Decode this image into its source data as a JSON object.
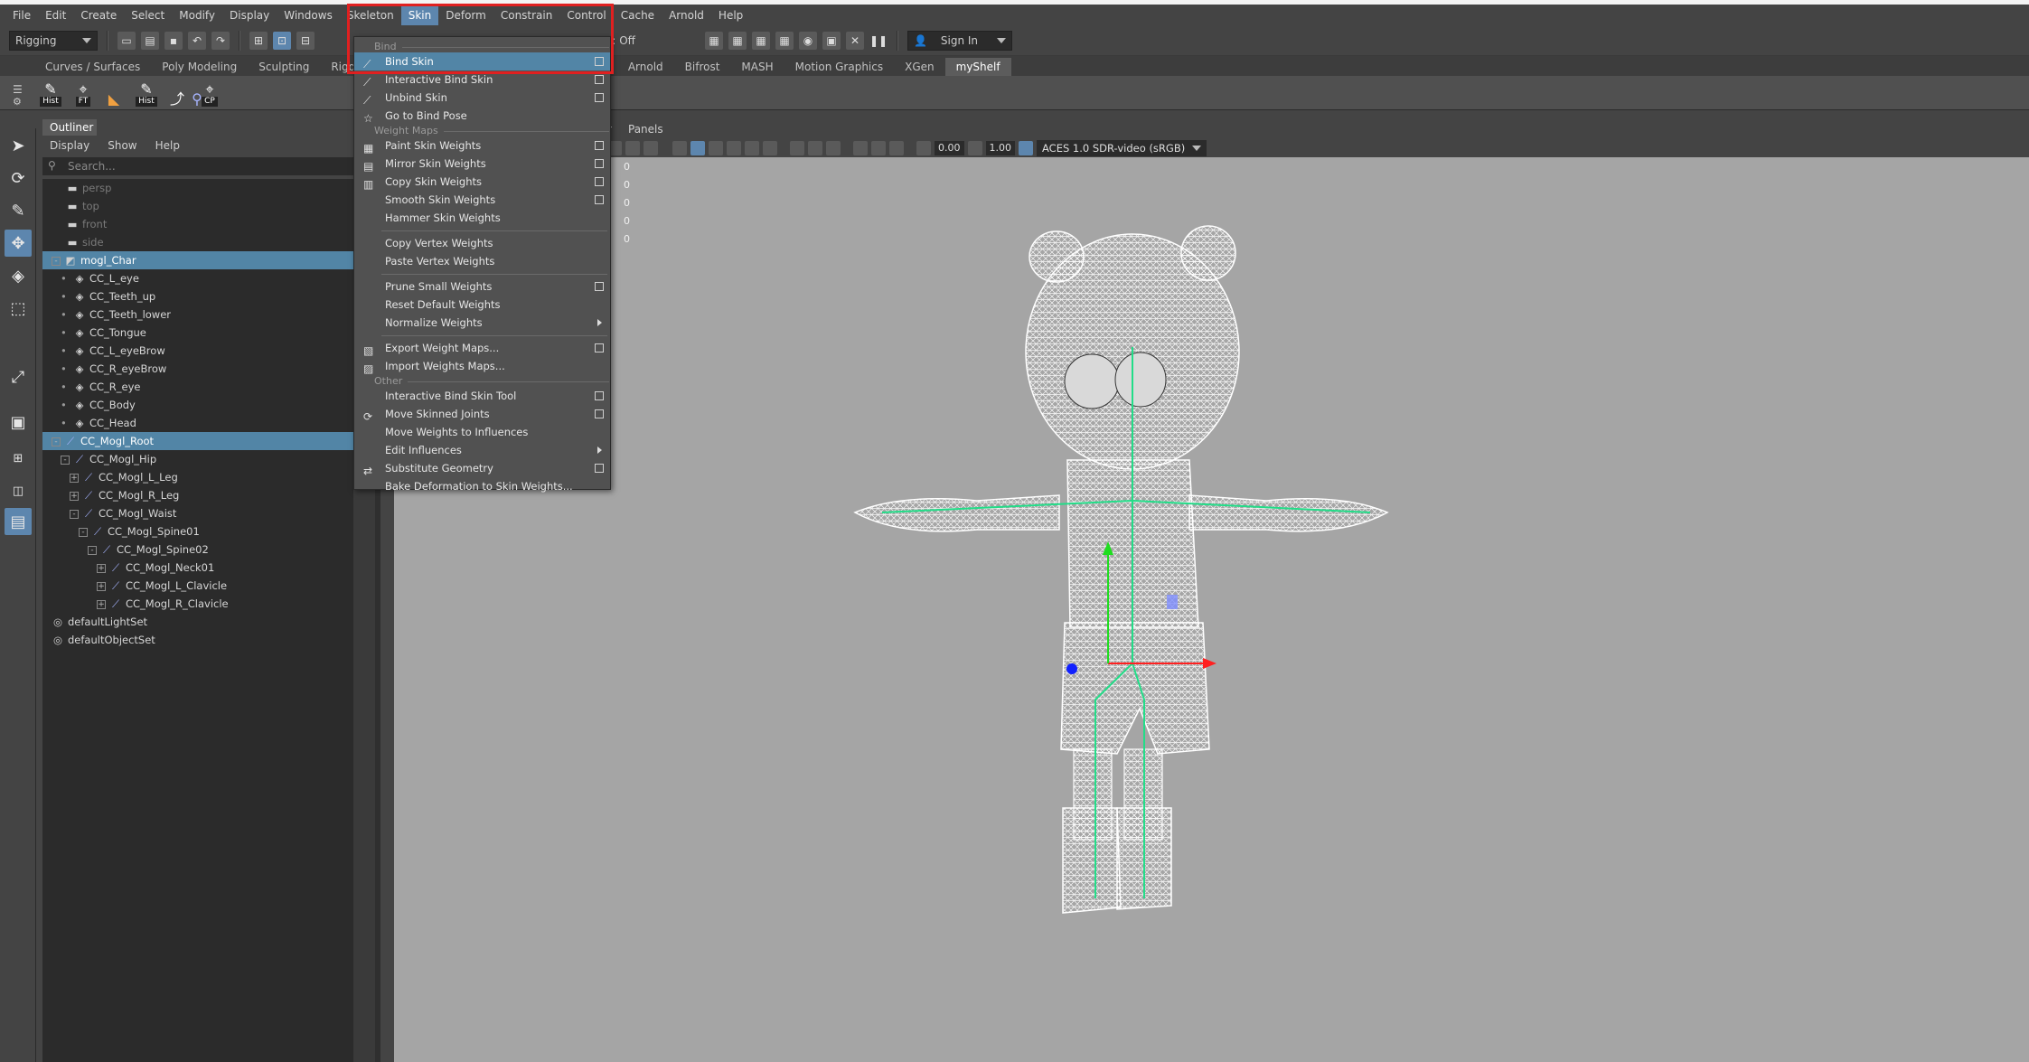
{
  "menubar": {
    "items": [
      "File",
      "Edit",
      "Create",
      "Select",
      "Modify",
      "Display",
      "Windows",
      "Skeleton",
      "Skin",
      "Deform",
      "Constrain",
      "Control",
      "Cache",
      "Arnold",
      "Help"
    ],
    "active": "Skin"
  },
  "statusline": {
    "mode": "Rigging",
    "symmetry": "Symmetry: Off",
    "sign_in": "Sign In"
  },
  "shelf": {
    "tabs": [
      "Curves / Surfaces",
      "Poly Modeling",
      "Sculpting",
      "Rigging",
      "",
      "stom",
      "Arnold",
      "Bifrost",
      "MASH",
      "Motion Graphics",
      "XGen",
      "myShelf"
    ],
    "selected": "myShelf",
    "buttons": [
      "Hist",
      "FT",
      "",
      "Hist",
      "",
      "",
      "CP"
    ]
  },
  "outliner": {
    "tab": "Outliner",
    "menu": [
      "Display",
      "Show",
      "Help"
    ],
    "search_placeholder": "Search...",
    "rows": [
      {
        "label": "persp",
        "icon": "camera-icon",
        "indent": 0,
        "dim": true
      },
      {
        "label": "top",
        "icon": "camera-icon",
        "indent": 0,
        "dim": true
      },
      {
        "label": "front",
        "icon": "camera-icon",
        "indent": 0,
        "dim": true
      },
      {
        "label": "side",
        "icon": "camera-icon",
        "indent": 0,
        "dim": true
      },
      {
        "label": "mogl_Char",
        "icon": "mesh-group-icon",
        "indent": 0,
        "selected": true,
        "expander": "-"
      },
      {
        "label": "CC_L_eye",
        "icon": "transform-icon",
        "indent": 1
      },
      {
        "label": "CC_Teeth_up",
        "icon": "transform-icon",
        "indent": 1
      },
      {
        "label": "CC_Teeth_lower",
        "icon": "transform-icon",
        "indent": 1
      },
      {
        "label": "CC_Tongue",
        "icon": "transform-icon",
        "indent": 1
      },
      {
        "label": "CC_L_eyeBrow",
        "icon": "transform-icon",
        "indent": 1
      },
      {
        "label": "CC_R_eyeBrow",
        "icon": "transform-icon",
        "indent": 1
      },
      {
        "label": "CC_R_eye",
        "icon": "transform-icon",
        "indent": 1
      },
      {
        "label": "CC_Body",
        "icon": "transform-icon",
        "indent": 1
      },
      {
        "label": "CC_Head",
        "icon": "transform-icon",
        "indent": 1
      },
      {
        "label": "CC_Mogl_Root",
        "icon": "joint-icon",
        "indent": 0,
        "selected": true,
        "expander": "-"
      },
      {
        "label": "CC_Mogl_Hip",
        "icon": "joint-icon",
        "indent": 1,
        "expander": "-"
      },
      {
        "label": "CC_Mogl_L_Leg",
        "icon": "joint-icon",
        "indent": 2,
        "expander": "+"
      },
      {
        "label": "CC_Mogl_R_Leg",
        "icon": "joint-icon",
        "indent": 2,
        "expander": "+"
      },
      {
        "label": "CC_Mogl_Waist",
        "icon": "joint-icon",
        "indent": 2,
        "expander": "-"
      },
      {
        "label": "CC_Mogl_Spine01",
        "icon": "joint-icon",
        "indent": 3,
        "expander": "-"
      },
      {
        "label": "CC_Mogl_Spine02",
        "icon": "joint-icon",
        "indent": 4,
        "expander": "-"
      },
      {
        "label": "CC_Mogl_Neck01",
        "icon": "joint-icon",
        "indent": 5,
        "expander": "+"
      },
      {
        "label": "CC_Mogl_L_Clavicle",
        "icon": "joint-icon",
        "indent": 5,
        "expander": "+"
      },
      {
        "label": "CC_Mogl_R_Clavicle",
        "icon": "joint-icon",
        "indent": 5,
        "expander": "+"
      },
      {
        "label": "defaultLightSet",
        "icon": "set-icon",
        "indent": 0
      },
      {
        "label": "defaultObjectSet",
        "icon": "set-icon",
        "indent": 0
      }
    ]
  },
  "viewport": {
    "menu": [
      "rer",
      "Panels"
    ],
    "value1": "0.00",
    "value2": "1.00",
    "colorspace": "ACES 1.0 SDR-video (sRGB)",
    "hud": [
      "0",
      "0",
      "0",
      "0",
      "0"
    ]
  },
  "skin_menu": {
    "items": [
      {
        "type": "header",
        "label": "Bind"
      },
      {
        "type": "item",
        "label": "Bind Skin",
        "option": true,
        "highlighted": true,
        "icon": "bind-skin-icon"
      },
      {
        "type": "item",
        "label": "Interactive Bind Skin",
        "option": true,
        "icon": "interactive-bind-icon"
      },
      {
        "type": "item",
        "label": "Unbind Skin",
        "option": true,
        "icon": "unbind-icon"
      },
      {
        "type": "item",
        "label": "Go to Bind Pose",
        "icon": "bind-pose-icon"
      },
      {
        "type": "header",
        "label": "Weight Maps"
      },
      {
        "type": "item",
        "label": "Paint Skin Weights",
        "option": true,
        "icon": "paint-weights-icon"
      },
      {
        "type": "item",
        "label": "Mirror Skin Weights",
        "option": true,
        "icon": "mirror-weights-icon"
      },
      {
        "type": "item",
        "label": "Copy Skin Weights",
        "option": true,
        "icon": "copy-weights-icon"
      },
      {
        "type": "item",
        "label": "Smooth Skin Weights",
        "option": true
      },
      {
        "type": "item",
        "label": "Hammer Skin Weights"
      },
      {
        "type": "divider"
      },
      {
        "type": "item",
        "label": "Copy Vertex Weights"
      },
      {
        "type": "item",
        "label": "Paste Vertex Weights"
      },
      {
        "type": "divider"
      },
      {
        "type": "item",
        "label": "Prune Small Weights",
        "option": true
      },
      {
        "type": "item",
        "label": "Reset Default Weights"
      },
      {
        "type": "item",
        "label": "Normalize Weights",
        "submenu": true
      },
      {
        "type": "divider"
      },
      {
        "type": "item",
        "label": "Export Weight Maps...",
        "option": true,
        "icon": "export-maps-icon"
      },
      {
        "type": "item",
        "label": "Import Weights Maps...",
        "icon": "import-maps-icon"
      },
      {
        "type": "header",
        "label": "Other"
      },
      {
        "type": "item",
        "label": "Interactive Bind Skin Tool",
        "option": true
      },
      {
        "type": "item",
        "label": "Move Skinned Joints",
        "option": true,
        "icon": "move-joints-icon"
      },
      {
        "type": "item",
        "label": "Move Weights to Influences"
      },
      {
        "type": "item",
        "label": "Edit Influences",
        "submenu": true
      },
      {
        "type": "item",
        "label": "Substitute Geometry",
        "option": true,
        "icon": "substitute-icon"
      },
      {
        "type": "item",
        "label": "Bake Deformation to Skin Weights..."
      }
    ]
  },
  "colors": {
    "highlight": "#5285a6",
    "menu_active": "#5d86ae",
    "annotation": "#e02020",
    "viewport_bg": "#a5a5a5"
  }
}
